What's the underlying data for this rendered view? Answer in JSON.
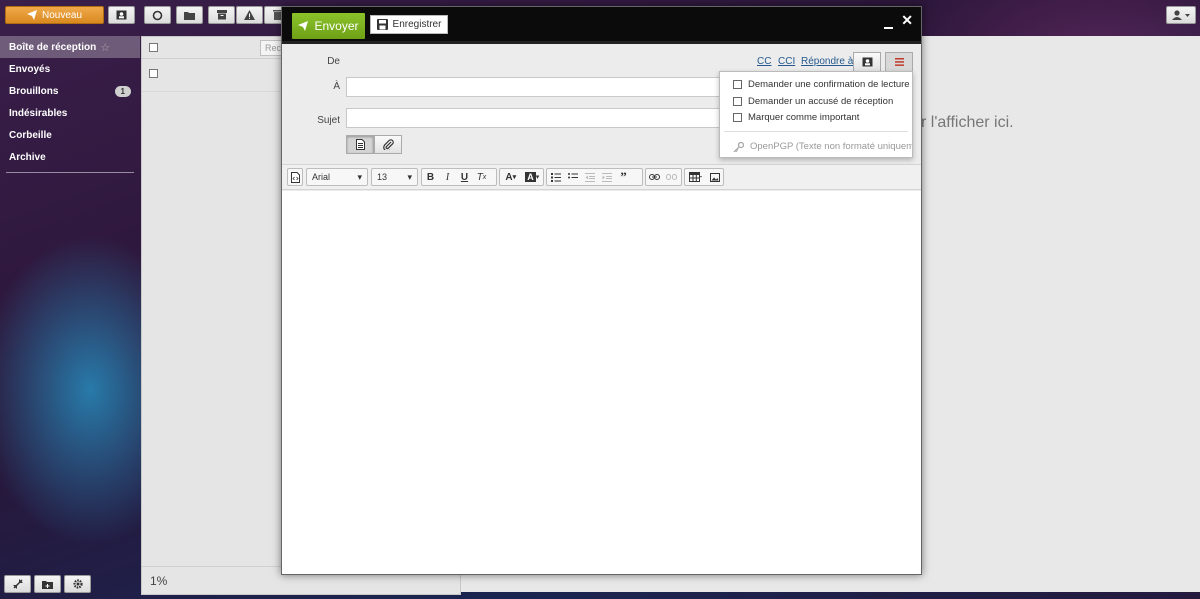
{
  "toolbar": {
    "new_label": "Nouveau",
    "icons": [
      "paper-plane-icon",
      "contact-card-icon",
      "refresh-icon",
      "folder-icon",
      "archive-icon",
      "warning-icon",
      "trash-icon",
      "user-icon"
    ]
  },
  "sidebar": {
    "items": [
      {
        "label": "Boîte de réception",
        "selected": true,
        "starred": false
      },
      {
        "label": "Envoyés"
      },
      {
        "label": "Brouillons",
        "badge": "1"
      },
      {
        "label": "Indésirables"
      },
      {
        "label": "Corbeille"
      },
      {
        "label": "Archive"
      }
    ]
  },
  "message_list": {
    "search_placeholder": "Rech",
    "footer_quota": "1%"
  },
  "preview": {
    "empty_text": "r l'afficher ici."
  },
  "compose": {
    "send_label": "Envoyer",
    "save_label": "Enregistrer",
    "from_label": "De",
    "to_label": "À",
    "subject_label": "Sujet",
    "cc_link": "CC",
    "bcc_link": "CCI",
    "reply_to_link": "Répondre à",
    "editor": {
      "font_family": "Arial",
      "font_size": "13"
    }
  },
  "options_menu": {
    "items": [
      {
        "label": "Demander une confirmation de lecture",
        "checked": false
      },
      {
        "label": "Demander un accusé de réception",
        "checked": false
      },
      {
        "label": "Marquer comme important",
        "checked": false
      }
    ],
    "openpgp_label": "OpenPGP (Texte non formaté uniquement)"
  },
  "colors": {
    "accent_orange": "#e39a34",
    "send_green": "#7cb31f",
    "link_blue": "#25598e",
    "menu_icon_red": "#c0392b"
  }
}
